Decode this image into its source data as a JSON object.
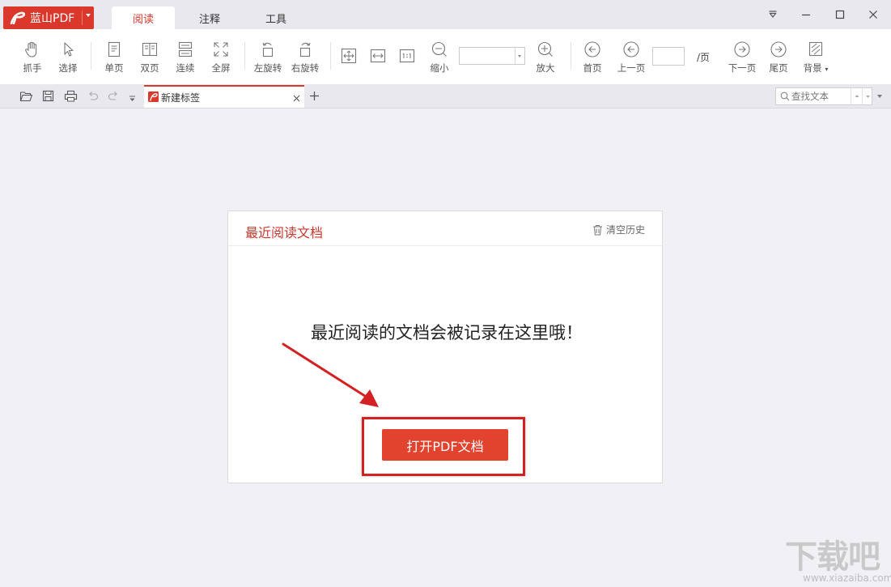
{
  "app": {
    "name": "蓝山PDF",
    "brand_color": "#d9382b"
  },
  "ribbon_tabs": [
    {
      "label": "阅读",
      "active": true
    },
    {
      "label": "注释",
      "active": false
    },
    {
      "label": "工具",
      "active": false
    }
  ],
  "window_controls": [
    "dropdown-icon",
    "minimize-icon",
    "maximize-icon",
    "close-icon"
  ],
  "toolbar": {
    "hand": "抓手",
    "select": "选择",
    "single_page": "单页",
    "double_page": "双页",
    "continuous": "连续",
    "fullscreen": "全屏",
    "rotate_left": "左旋转",
    "rotate_right": "右旋转",
    "zoom_out": "缩小",
    "zoom_value": "",
    "zoom_in": "放大",
    "first_page": "首页",
    "prev_page": "上一页",
    "page_value": "",
    "page_suffix": "/页",
    "next_page": "下一页",
    "last_page": "尾页",
    "background": "背景"
  },
  "tabstrip": {
    "document_tab": "新建标签",
    "search_placeholder": "查找文本"
  },
  "recent": {
    "title": "最近阅读文档",
    "clear_history": "清空历史",
    "empty_message": "最近阅读的文档会被记录在这里哦！",
    "open_button": "打开PDF文档",
    "accent_color": "#c8382c",
    "button_color": "#e2432f",
    "annotation_color": "#d42121"
  },
  "watermark": {
    "text": "下载吧",
    "url": "www.xiazaiba.com"
  }
}
